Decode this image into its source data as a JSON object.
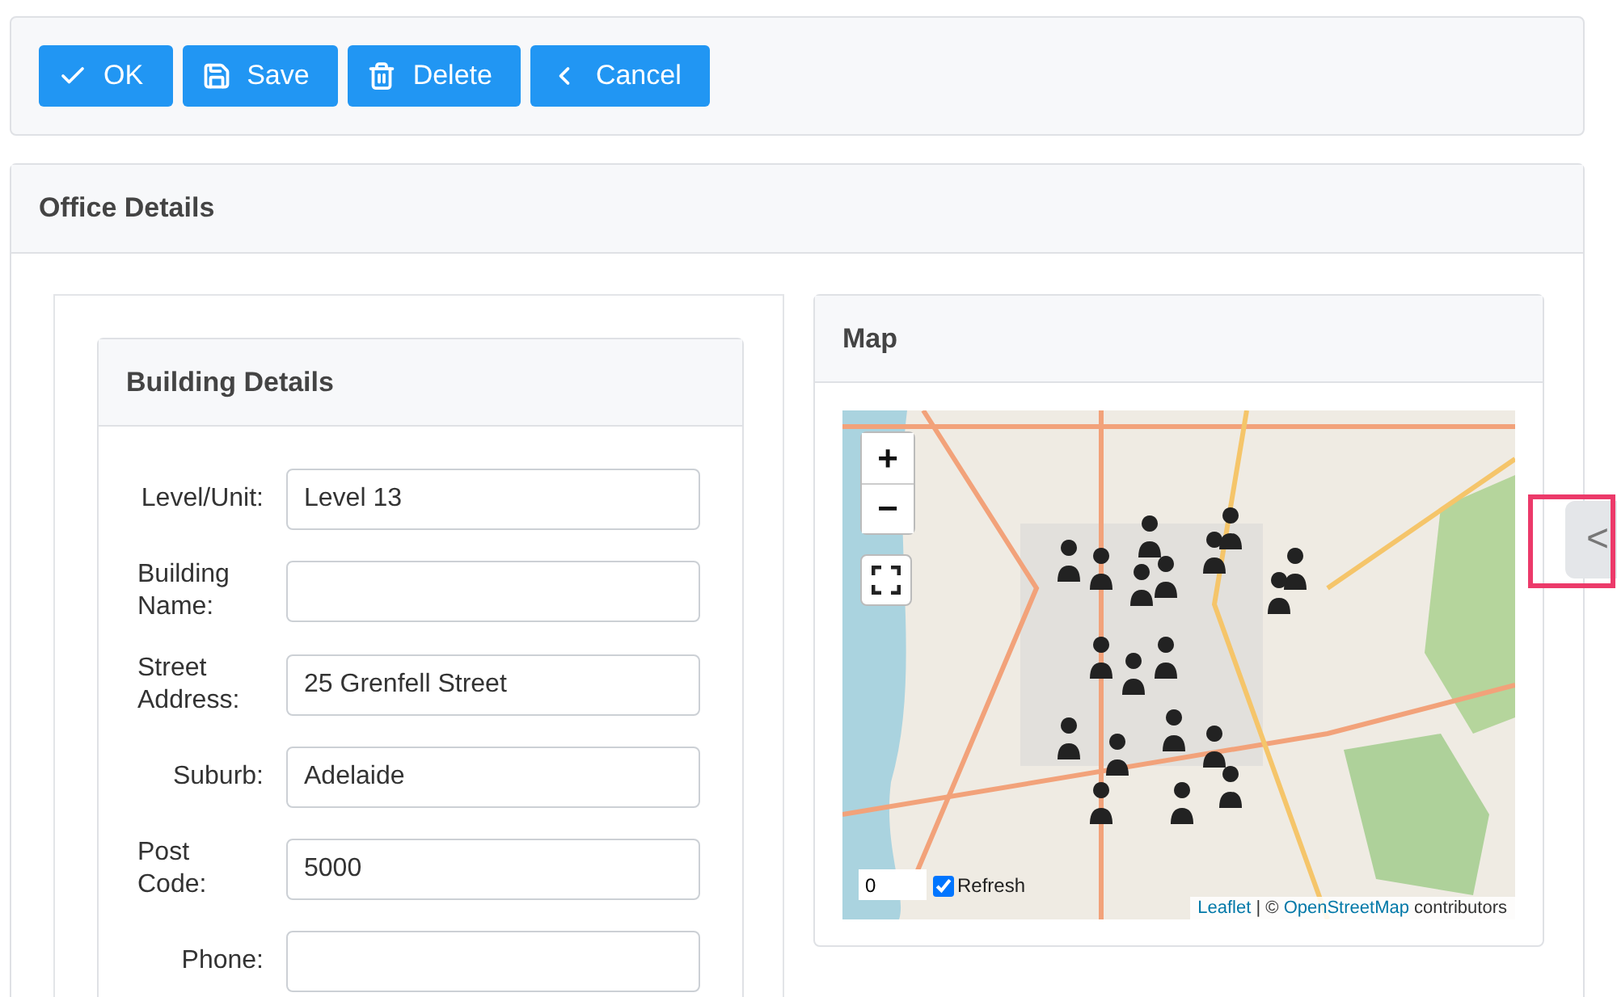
{
  "toolbar": {
    "buttons": [
      {
        "kind": "ok",
        "label": "OK"
      },
      {
        "kind": "save",
        "label": "Save"
      },
      {
        "kind": "delete",
        "label": "Delete"
      },
      {
        "kind": "cancel",
        "label": "Cancel"
      }
    ]
  },
  "office_panel": {
    "title": "Office Details",
    "building": {
      "title": "Building Details",
      "fields": [
        {
          "label": "Level/Unit:",
          "value": "Level 13"
        },
        {
          "label": "Building Name:"
        },
        {
          "label": "Street Address:",
          "value": "25 Grenfell Street"
        },
        {
          "label": "Suburb:",
          "value": "Adelaide"
        },
        {
          "label": "Post Code:",
          "value": "5000"
        },
        {
          "label": "Phone:"
        }
      ]
    },
    "map": {
      "title": "Map",
      "zoom_in": "+",
      "zoom_out": "−",
      "spinner_value": "0",
      "refresh": {
        "label": "Refresh",
        "checked": true
      },
      "attribution": [
        {
          "kind": "link",
          "text": "Leaflet"
        },
        {
          "kind": "text",
          "text": " | © "
        },
        {
          "kind": "link",
          "text": "OpenStreetMap"
        },
        {
          "kind": "text",
          "text": " contributors"
        }
      ]
    }
  },
  "side_tab": {
    "label": "<",
    "highlighted": true
  }
}
